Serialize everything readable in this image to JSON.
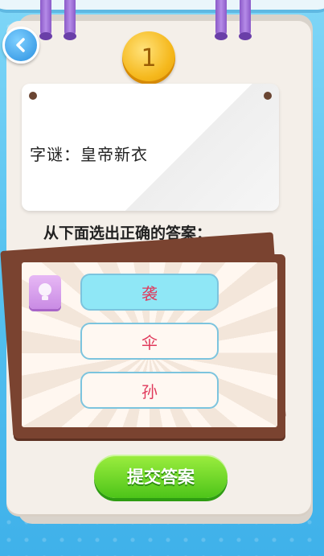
{
  "level": "1",
  "riddle": "字谜：皇帝新衣",
  "prompt": "从下面选出正确的答案：",
  "options": [
    "袭",
    "伞",
    "孙"
  ],
  "selected_index": 0,
  "submit_label": "提交答案",
  "icons": {
    "back": "back-arrow-icon",
    "hint": "lightbulb-icon"
  },
  "colors": {
    "accent": "#e03a5c",
    "selected": "#8fe7f6",
    "submit": "#4dc419"
  }
}
